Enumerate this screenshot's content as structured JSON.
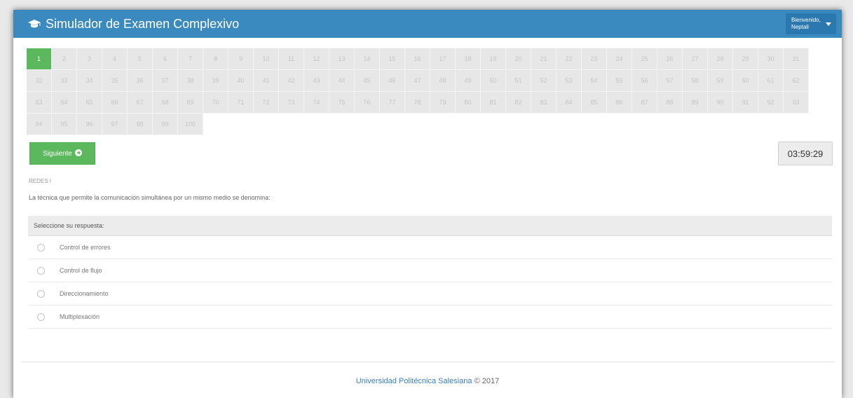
{
  "navbar": {
    "title": "Simulador de Examen Complexivo",
    "brand_icon": "graduation-cap-icon",
    "user_greeting": "Bienvenido,",
    "user_name": "Neptali",
    "caret_icon": "caret-down-icon"
  },
  "pager": {
    "active": 1,
    "pages": [
      1,
      2,
      3,
      4,
      5,
      6,
      7,
      8,
      9,
      10,
      11,
      12,
      13,
      14,
      15,
      16,
      17,
      18,
      19,
      20,
      21,
      22,
      23,
      24,
      25,
      26,
      27,
      28,
      29,
      30,
      31,
      32,
      33,
      34,
      35,
      36,
      37,
      38,
      39,
      40,
      41,
      42,
      43,
      44,
      45,
      46,
      47,
      48,
      49,
      50,
      51,
      52,
      53,
      54,
      55,
      56,
      57,
      58,
      59,
      60,
      61,
      62,
      63,
      64,
      65,
      66,
      67,
      68,
      69,
      70,
      71,
      72,
      73,
      74,
      75,
      76,
      77,
      78,
      79,
      80,
      81,
      82,
      83,
      84,
      85,
      86,
      87,
      88,
      89,
      90,
      91,
      92,
      93,
      94,
      95,
      96,
      97,
      98,
      99,
      100
    ]
  },
  "controls": {
    "next_label": "Siguiente",
    "next_icon": "arrow-right-icon",
    "timer": "03:59:29"
  },
  "question": {
    "code": "REDES I",
    "text": "La técnica que permite la comunicación simultánea por un mismo medio se denomina:"
  },
  "answers": {
    "header": "Seleccione su respuesta:",
    "options": [
      "Control de errores",
      "Control de flujo",
      "Direccionamiento",
      "Multiplexación"
    ]
  },
  "footer": {
    "university": "Universidad Politécnica Salesiana",
    "copyright": "© 2017"
  },
  "colors": {
    "navbar": "#3a8ac0",
    "active_page": "#5cb85c",
    "next_button": "#5cb85c",
    "footer_link": "#3a7fc1"
  }
}
